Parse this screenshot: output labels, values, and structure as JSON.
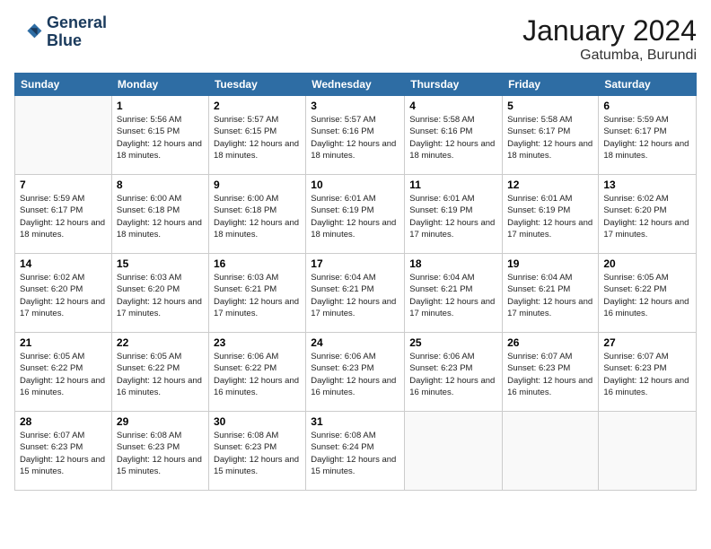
{
  "logo": {
    "line1": "General",
    "line2": "Blue"
  },
  "header": {
    "month": "January 2024",
    "location": "Gatumba, Burundi"
  },
  "days_of_week": [
    "Sunday",
    "Monday",
    "Tuesday",
    "Wednesday",
    "Thursday",
    "Friday",
    "Saturday"
  ],
  "weeks": [
    [
      {
        "day": "",
        "sunrise": "",
        "sunset": "",
        "daylight": ""
      },
      {
        "day": "1",
        "sunrise": "5:56 AM",
        "sunset": "6:15 PM",
        "daylight": "12 hours and 18 minutes."
      },
      {
        "day": "2",
        "sunrise": "5:57 AM",
        "sunset": "6:15 PM",
        "daylight": "12 hours and 18 minutes."
      },
      {
        "day": "3",
        "sunrise": "5:57 AM",
        "sunset": "6:16 PM",
        "daylight": "12 hours and 18 minutes."
      },
      {
        "day": "4",
        "sunrise": "5:58 AM",
        "sunset": "6:16 PM",
        "daylight": "12 hours and 18 minutes."
      },
      {
        "day": "5",
        "sunrise": "5:58 AM",
        "sunset": "6:17 PM",
        "daylight": "12 hours and 18 minutes."
      },
      {
        "day": "6",
        "sunrise": "5:59 AM",
        "sunset": "6:17 PM",
        "daylight": "12 hours and 18 minutes."
      }
    ],
    [
      {
        "day": "7",
        "sunrise": "5:59 AM",
        "sunset": "6:17 PM",
        "daylight": "12 hours and 18 minutes."
      },
      {
        "day": "8",
        "sunrise": "6:00 AM",
        "sunset": "6:18 PM",
        "daylight": "12 hours and 18 minutes."
      },
      {
        "day": "9",
        "sunrise": "6:00 AM",
        "sunset": "6:18 PM",
        "daylight": "12 hours and 18 minutes."
      },
      {
        "day": "10",
        "sunrise": "6:01 AM",
        "sunset": "6:19 PM",
        "daylight": "12 hours and 18 minutes."
      },
      {
        "day": "11",
        "sunrise": "6:01 AM",
        "sunset": "6:19 PM",
        "daylight": "12 hours and 17 minutes."
      },
      {
        "day": "12",
        "sunrise": "6:01 AM",
        "sunset": "6:19 PM",
        "daylight": "12 hours and 17 minutes."
      },
      {
        "day": "13",
        "sunrise": "6:02 AM",
        "sunset": "6:20 PM",
        "daylight": "12 hours and 17 minutes."
      }
    ],
    [
      {
        "day": "14",
        "sunrise": "6:02 AM",
        "sunset": "6:20 PM",
        "daylight": "12 hours and 17 minutes."
      },
      {
        "day": "15",
        "sunrise": "6:03 AM",
        "sunset": "6:20 PM",
        "daylight": "12 hours and 17 minutes."
      },
      {
        "day": "16",
        "sunrise": "6:03 AM",
        "sunset": "6:21 PM",
        "daylight": "12 hours and 17 minutes."
      },
      {
        "day": "17",
        "sunrise": "6:04 AM",
        "sunset": "6:21 PM",
        "daylight": "12 hours and 17 minutes."
      },
      {
        "day": "18",
        "sunrise": "6:04 AM",
        "sunset": "6:21 PM",
        "daylight": "12 hours and 17 minutes."
      },
      {
        "day": "19",
        "sunrise": "6:04 AM",
        "sunset": "6:21 PM",
        "daylight": "12 hours and 17 minutes."
      },
      {
        "day": "20",
        "sunrise": "6:05 AM",
        "sunset": "6:22 PM",
        "daylight": "12 hours and 16 minutes."
      }
    ],
    [
      {
        "day": "21",
        "sunrise": "6:05 AM",
        "sunset": "6:22 PM",
        "daylight": "12 hours and 16 minutes."
      },
      {
        "day": "22",
        "sunrise": "6:05 AM",
        "sunset": "6:22 PM",
        "daylight": "12 hours and 16 minutes."
      },
      {
        "day": "23",
        "sunrise": "6:06 AM",
        "sunset": "6:22 PM",
        "daylight": "12 hours and 16 minutes."
      },
      {
        "day": "24",
        "sunrise": "6:06 AM",
        "sunset": "6:23 PM",
        "daylight": "12 hours and 16 minutes."
      },
      {
        "day": "25",
        "sunrise": "6:06 AM",
        "sunset": "6:23 PM",
        "daylight": "12 hours and 16 minutes."
      },
      {
        "day": "26",
        "sunrise": "6:07 AM",
        "sunset": "6:23 PM",
        "daylight": "12 hours and 16 minutes."
      },
      {
        "day": "27",
        "sunrise": "6:07 AM",
        "sunset": "6:23 PM",
        "daylight": "12 hours and 16 minutes."
      }
    ],
    [
      {
        "day": "28",
        "sunrise": "6:07 AM",
        "sunset": "6:23 PM",
        "daylight": "12 hours and 15 minutes."
      },
      {
        "day": "29",
        "sunrise": "6:08 AM",
        "sunset": "6:23 PM",
        "daylight": "12 hours and 15 minutes."
      },
      {
        "day": "30",
        "sunrise": "6:08 AM",
        "sunset": "6:23 PM",
        "daylight": "12 hours and 15 minutes."
      },
      {
        "day": "31",
        "sunrise": "6:08 AM",
        "sunset": "6:24 PM",
        "daylight": "12 hours and 15 minutes."
      },
      {
        "day": "",
        "sunrise": "",
        "sunset": "",
        "daylight": ""
      },
      {
        "day": "",
        "sunrise": "",
        "sunset": "",
        "daylight": ""
      },
      {
        "day": "",
        "sunrise": "",
        "sunset": "",
        "daylight": ""
      }
    ]
  ],
  "labels": {
    "sunrise_prefix": "Sunrise: ",
    "sunset_prefix": "Sunset: ",
    "daylight_prefix": "Daylight: "
  }
}
